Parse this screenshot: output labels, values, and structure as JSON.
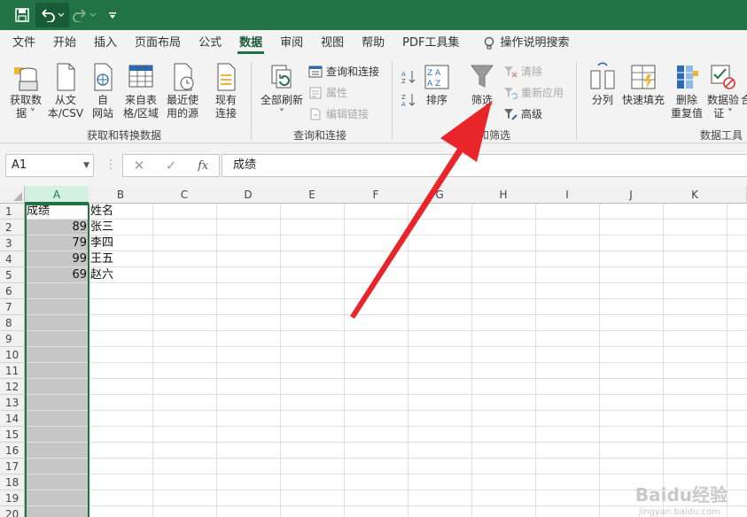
{
  "quick_access": {
    "save_icon": "save-icon",
    "undo_icon": "undo-icon",
    "redo_icon": "redo-icon",
    "customize_icon": "customize-qat-icon"
  },
  "tabs": [
    "文件",
    "开始",
    "插入",
    "页面布局",
    "公式",
    "数据",
    "审阅",
    "视图",
    "帮助",
    "PDF工具集"
  ],
  "active_tab": "数据",
  "tell_me": "操作说明搜索",
  "ribbon": {
    "get_transform": {
      "group_label": "获取和转换数据",
      "get_data": [
        "获取数",
        "据 ˅"
      ],
      "from_csv": [
        "从文",
        "本/CSV"
      ],
      "from_web": [
        "自",
        "网站"
      ],
      "from_table": [
        "来自表",
        "格/区域"
      ],
      "recent_sources": [
        "最近使",
        "用的源"
      ],
      "existing_conn": [
        "现有",
        "连接"
      ]
    },
    "queries": {
      "group_label": "查询和连接",
      "refresh_all": [
        "全部刷新",
        "˅"
      ],
      "queries_conn": "查询和连接",
      "properties": "属性",
      "edit_links": "编辑链接"
    },
    "sort_filter": {
      "group_label": "和筛选",
      "sort": "排序",
      "filter": "筛选",
      "clear": "清除",
      "reapply": "重新应用",
      "advanced": "高级"
    },
    "data_tools": {
      "group_label": "数据工具",
      "split": "分列",
      "flash_fill": "快速填充",
      "remove_dup": [
        "删除",
        "重复值"
      ],
      "validation": [
        "数据验",
        "证 ˅"
      ],
      "more": "合"
    }
  },
  "formula_bar": {
    "name_box": "A1",
    "cancel": "✕",
    "enter": "✓",
    "fx": "fx",
    "content": "成绩"
  },
  "columns": [
    "A",
    "B",
    "C",
    "D",
    "E",
    "F",
    "G",
    "H",
    "I",
    "J",
    "K"
  ],
  "rows": [
    "1",
    "2",
    "3",
    "4",
    "5",
    "6",
    "7",
    "8",
    "9",
    "10",
    "11",
    "12",
    "13",
    "14",
    "15",
    "16",
    "17",
    "18",
    "19",
    "20"
  ],
  "cells": {
    "A1": "成绩",
    "B1": "姓名",
    "A2": "89",
    "B2": "张三",
    "A3": "79",
    "B3": "李四",
    "A4": "99",
    "B4": "王五",
    "A5": "69",
    "B5": "赵六"
  },
  "watermark": "Baidu经验",
  "watermark_sub": "jingyan.baidu.com",
  "colors": {
    "accent": "#217346",
    "arrow": "#e8252a"
  }
}
